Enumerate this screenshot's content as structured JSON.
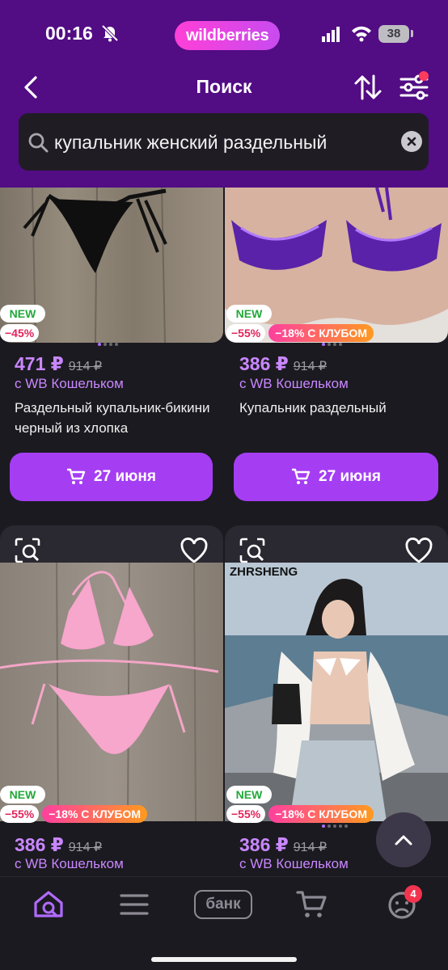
{
  "status": {
    "time": "00:16",
    "brand": "wildberries",
    "battery": "38"
  },
  "header": {
    "title": "Поиск"
  },
  "search": {
    "query": "купальник женский раздельный"
  },
  "products": [
    {
      "badge_new": "NEW",
      "discount": "−45%",
      "club": "",
      "price": "471 ₽",
      "old_price": "914 ₽",
      "wallet": "с WB Кошельком",
      "title": "Раздельный купальник-бикини черный из хлопка",
      "delivery": "27 июня"
    },
    {
      "badge_new": "NEW",
      "discount": "−55%",
      "club": "−18% С КЛУБОМ",
      "price": "386 ₽",
      "old_price": "914 ₽",
      "wallet": "с WB Кошельком",
      "title": "Купальник раздельный",
      "delivery": "27 июня"
    },
    {
      "badge_new": "NEW",
      "discount": "−55%",
      "club": "−18% С КЛУБОМ",
      "price": "386 ₽",
      "old_price": "914 ₽",
      "wallet": "с WB Кошельком"
    },
    {
      "badge_new": "NEW",
      "discount": "−55%",
      "club": "−18% С КЛУБОМ",
      "price": "386 ₽",
      "old_price": "914 ₽",
      "wallet": "с WB Кошельком",
      "image_text": "ZHRSHENG"
    }
  ],
  "bottom_nav": {
    "bank_label": "банк",
    "profile_badge": "4"
  },
  "colors": {
    "header": "#520c84",
    "accent": "#a53df3",
    "price": "#c987ff",
    "background": "#1b1a20"
  }
}
